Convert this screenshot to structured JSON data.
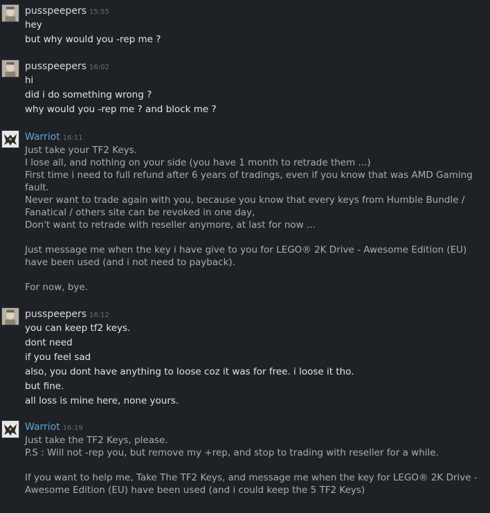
{
  "messages": [
    {
      "author": "pusspeepers",
      "time": "15:55",
      "avatar": "avatar-pusspeepers",
      "lines": [
        "hey",
        "but why would you -rep me ?"
      ]
    },
    {
      "author": "pusspeepers",
      "time": "16:02",
      "avatar": "avatar-pusspeepers",
      "lines": [
        "hi",
        "did i do something wrong ?",
        "why would you -rep me ? and block me ?"
      ]
    },
    {
      "author": "Warriot",
      "time": "16:11",
      "avatar": "avatar-warriot",
      "paragraphs": [
        "Just take your TF2 Keys.\nI lose all, and nothing on your side (you have 1 month to retrade them ...)\nFirst time i need to full refund after 6 years of tradings, even if you know that was AMD Gaming fault.\nNever want to trade again with you, because you know that every keys from Humble Bundle / Fanatical / others site can be revoked in one day,\nDon't want to retrade with reseller anymore, at last for now ...",
        "Just message me when the key i have give to you for LEGO® 2K Drive - Awesome Edition (EU) have been used (and i not need to payback).",
        "For now, bye."
      ]
    },
    {
      "author": "pusspeepers",
      "time": "16:12",
      "avatar": "avatar-pusspeepers",
      "lines": [
        "you can keep tf2 keys.",
        "dont need",
        "if you feel sad",
        "also, you dont have anything to loose coz it was for free. i loose it tho.",
        "but fine.",
        "all loss is mine here, none yours."
      ]
    },
    {
      "author": "Warriot",
      "time": "16:19",
      "avatar": "avatar-warriot",
      "paragraphs": [
        "Just take the TF2 Keys, please.\nP.S : Will not -rep you, but remove my +rep, and stop to trading with reseller for a while.",
        "If you want to help me, Take The TF2 Keys, and message me when the key for LEGO® 2K Drive - Awesome Edition (EU) have been used (and i could keep the 5 TF2 Keys)"
      ]
    }
  ],
  "colors": {
    "background": "#1e2126",
    "friend_name": "#d9dbdc",
    "my_name": "#62a6d9",
    "timestamp": "#6b7077"
  }
}
